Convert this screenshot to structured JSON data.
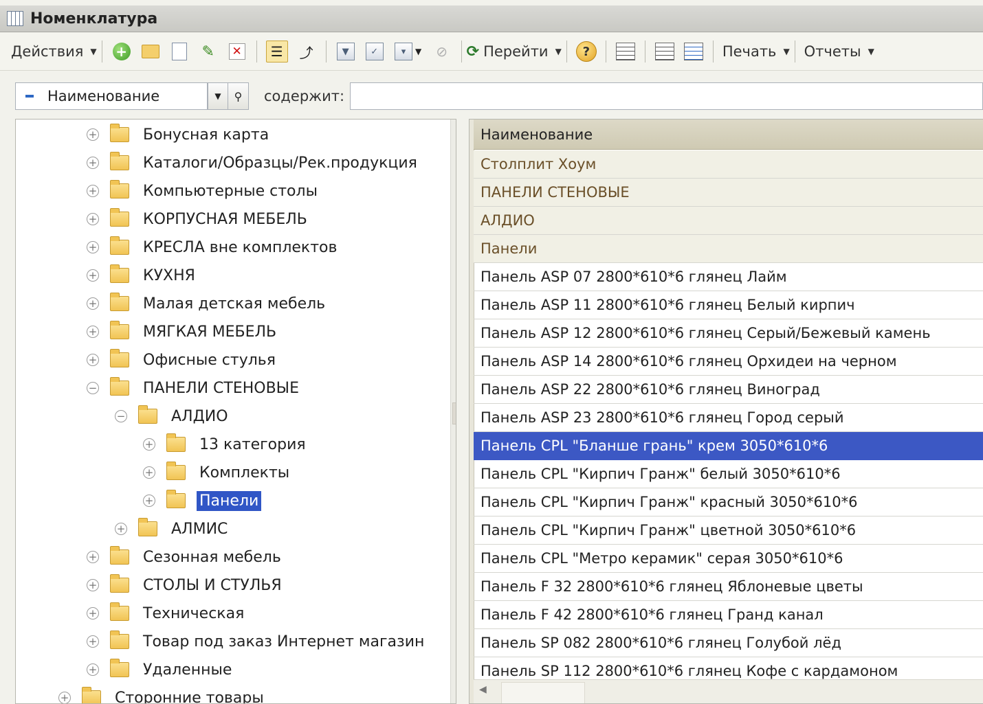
{
  "window": {
    "title": "Номенклатура"
  },
  "toolbar": {
    "actions_label": "Действия",
    "goto_label": "Перейти",
    "print_label": "Печать",
    "reports_label": "Отчеты"
  },
  "search": {
    "field_value": "Наименование",
    "contains_label": "содержит:",
    "input_value": ""
  },
  "tree": {
    "items": [
      {
        "label": "Бонусная карта",
        "level": 2,
        "expander": "plus"
      },
      {
        "label": "Каталоги/Образцы/Рек.продукция",
        "level": 2,
        "expander": "plus"
      },
      {
        "label": "Компьютерные столы",
        "level": 2,
        "expander": "plus"
      },
      {
        "label": "КОРПУСНАЯ МЕБЕЛЬ",
        "level": 2,
        "expander": "plus"
      },
      {
        "label": "КРЕСЛА вне комплектов",
        "level": 2,
        "expander": "plus"
      },
      {
        "label": "КУХНЯ",
        "level": 2,
        "expander": "plus"
      },
      {
        "label": "Малая детская мебель",
        "level": 2,
        "expander": "plus"
      },
      {
        "label": "МЯГКАЯ МЕБЕЛЬ",
        "level": 2,
        "expander": "plus"
      },
      {
        "label": "Офисные стулья",
        "level": 2,
        "expander": "plus"
      },
      {
        "label": "ПАНЕЛИ СТЕНОВЫЕ",
        "level": 2,
        "expander": "minus"
      },
      {
        "label": "АЛДИО",
        "level": 3,
        "expander": "minus"
      },
      {
        "label": "13 категория",
        "level": 4,
        "expander": "plus"
      },
      {
        "label": "Комплекты",
        "level": 4,
        "expander": "plus"
      },
      {
        "label": "Панели",
        "level": 4,
        "expander": "plus",
        "selected": true
      },
      {
        "label": "АЛМИС",
        "level": 3,
        "expander": "plus"
      },
      {
        "label": "Сезонная мебель",
        "level": 2,
        "expander": "plus"
      },
      {
        "label": "СТОЛЫ И СТУЛЬЯ",
        "level": 2,
        "expander": "plus"
      },
      {
        "label": "Техническая",
        "level": 2,
        "expander": "plus"
      },
      {
        "label": "Товар под заказ Интернет магазин",
        "level": 2,
        "expander": "plus"
      },
      {
        "label": "Удаленные",
        "level": 2,
        "expander": "plus"
      },
      {
        "label": "Сторонние товары",
        "level": 1,
        "expander": "plus"
      }
    ]
  },
  "grid": {
    "column_header": "Наименование",
    "rows": [
      {
        "name": "Столплит Хоум",
        "group": true
      },
      {
        "name": "ПАНЕЛИ СТЕНОВЫЕ",
        "group": true
      },
      {
        "name": "АЛДИО",
        "group": true
      },
      {
        "name": "Панели",
        "group": true
      },
      {
        "name": "Панель ASP 07 2800*610*6 глянец Лайм"
      },
      {
        "name": "Панель ASP 11 2800*610*6 глянец Белый кирпич"
      },
      {
        "name": "Панель ASP 12 2800*610*6 глянец Серый/Бежевый камень"
      },
      {
        "name": "Панель ASP 14 2800*610*6 глянец Орхидеи на черном"
      },
      {
        "name": "Панель ASP 22 2800*610*6 глянец Виноград"
      },
      {
        "name": "Панель ASP 23 2800*610*6 глянец Город серый"
      },
      {
        "name": "Панель CPL \"Бланше грань\" крем 3050*610*6",
        "selected": true
      },
      {
        "name": "Панель CPL \"Кирпич Гранж\" белый 3050*610*6"
      },
      {
        "name": "Панель CPL \"Кирпич Гранж\" красный 3050*610*6"
      },
      {
        "name": "Панель CPL \"Кирпич Гранж\" цветной 3050*610*6"
      },
      {
        "name": "Панель CPL \"Метро керамик\" серая 3050*610*6"
      },
      {
        "name": "Панель F 32 2800*610*6 глянец Яблоневые цветы"
      },
      {
        "name": "Панель F 42 2800*610*6 глянец Гранд канал"
      },
      {
        "name": "Панель SP 082 2800*610*6 глянец Голубой лёд"
      },
      {
        "name": "Панель SP 112 2800*610*6 глянец Кофе с кардамоном"
      }
    ]
  },
  "colors": {
    "selection": "#3c58c4",
    "group_row_bg": "#f1f0e5",
    "header_bg": "#cfcab3"
  }
}
